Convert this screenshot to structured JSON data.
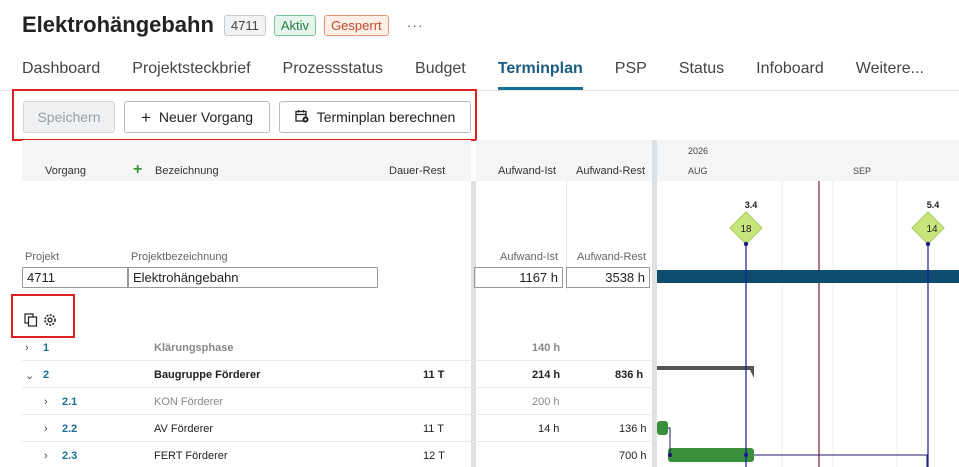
{
  "header": {
    "title": "Elektrohängebahn",
    "number": "4711",
    "status_active": "Aktiv",
    "status_locked": "Gesperrt",
    "more": "···"
  },
  "tabs": [
    {
      "label": "Dashboard"
    },
    {
      "label": "Projektsteckbrief"
    },
    {
      "label": "Prozessstatus"
    },
    {
      "label": "Budget"
    },
    {
      "label": "Terminplan"
    },
    {
      "label": "PSP"
    },
    {
      "label": "Status"
    },
    {
      "label": "Infoboard"
    },
    {
      "label": "Weitere..."
    }
  ],
  "active_tab": "Terminplan",
  "toolbar": {
    "save": "Speichern",
    "new_task": "Neuer Vorgang",
    "calculate": "Terminplan berechnen"
  },
  "columns": {
    "vorgang": "Vorgang",
    "plus": "+",
    "bezeichnung": "Bezeichnung",
    "dauer_rest": "Dauer-Rest",
    "aufwand_ist": "Aufwand-Ist",
    "aufwand_rest": "Aufwand-Rest"
  },
  "timeline": {
    "year": "2026",
    "month1": "AUG",
    "month2": "SEP",
    "milestone1": {
      "date": "3.4",
      "number": "18"
    },
    "milestone2": {
      "date": "5.4",
      "number": "14"
    }
  },
  "project": {
    "label_projekt": "Projekt",
    "label_bezeichnung": "Projektbezeichnung",
    "label_aufwand_ist": "Aufwand-Ist",
    "label_aufwand_rest": "Aufwand-Rest",
    "id": "4711",
    "name": "Elektrohängebahn",
    "aufwand_ist": "1167 h",
    "aufwand_rest": "3538 h"
  },
  "rows": [
    {
      "id": "1",
      "name": "Klärungsphase",
      "dauer": "",
      "ist": "140 h",
      "rest": ""
    },
    {
      "id": "2",
      "name": "Baugruppe Förderer",
      "dauer": "11 T",
      "ist": "214 h",
      "rest": "836 h"
    },
    {
      "id": "2.1",
      "name": "KON Förderer",
      "dauer": "",
      "ist": "200 h",
      "rest": ""
    },
    {
      "id": "2.2",
      "name": "AV Förderer",
      "dauer": "11 T",
      "ist": "14 h",
      "rest": "136 h"
    },
    {
      "id": "2.3",
      "name": "FERT Förderer",
      "dauer": "12 T",
      "ist": "",
      "rest": "700 h"
    }
  ],
  "colors": {
    "accent": "#1a6f95",
    "project_bar": "#0f4c6e",
    "task_bar": "#3a8f3a",
    "summary_bar": "#555555",
    "milestone": "#c6e57a",
    "today_line": "#8a1a3a",
    "highlight": "#e02020"
  }
}
